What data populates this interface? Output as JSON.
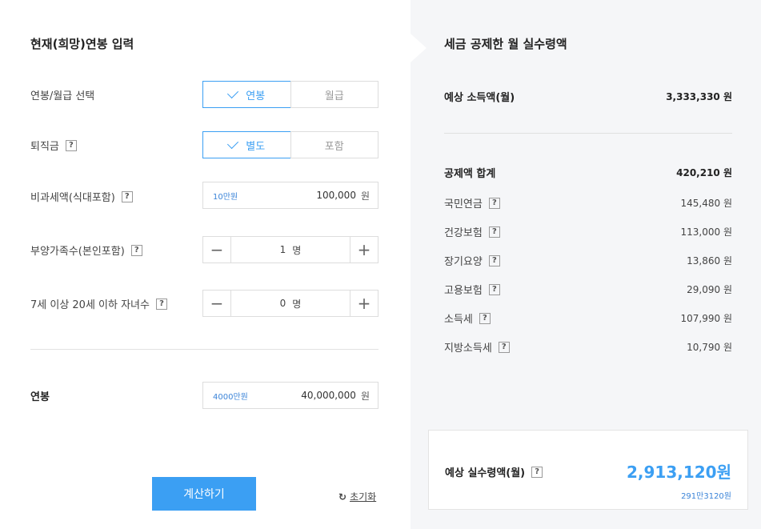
{
  "left": {
    "title": "현재(희망)연봉 입력",
    "salary_type": {
      "label": "연봉/월급 선택",
      "options": [
        "연봉",
        "월급"
      ],
      "selected": "연봉"
    },
    "severance": {
      "label": "퇴직금",
      "options": [
        "별도",
        "포함"
      ],
      "selected": "별도"
    },
    "nontaxable": {
      "label": "비과세액(식대포함)",
      "hint": "10만원",
      "value": "100,000",
      "unit": "원"
    },
    "dependents": {
      "label": "부양가족수(본인포함)",
      "value": "1",
      "unit": "명",
      "minus": "−",
      "plus": "+"
    },
    "children": {
      "label": "7세 이상 20세 이하 자녀수",
      "value": "0",
      "unit": "명",
      "minus": "−",
      "plus": "+"
    },
    "annual": {
      "label": "연봉",
      "hint": "4000만원",
      "value": "40,000,000",
      "unit": "원"
    },
    "calculate_label": "계산하기",
    "reset_label": "초기화",
    "help_glyph": "?"
  },
  "right": {
    "title": "세금 공제한 월 실수령액",
    "expected_income": {
      "label": "예상 소득액(월)",
      "value": "3,333,330 원"
    },
    "deduction_total": {
      "label": "공제액 합계",
      "value": "420,210 원"
    },
    "items": [
      {
        "label": "국민연금",
        "value": "145,480 원"
      },
      {
        "label": "건강보험",
        "value": "113,000 원"
      },
      {
        "label": "장기요양",
        "value": "13,860 원"
      },
      {
        "label": "고용보험",
        "value": "29,090 원"
      },
      {
        "label": "소득세",
        "value": "107,990 원"
      },
      {
        "label": "지방소득세",
        "value": "10,790 원"
      }
    ],
    "result": {
      "label": "예상 실수령액(월)",
      "value": "2,913,120원",
      "sub": "291만3120원"
    }
  },
  "colors": {
    "accent": "#3b9ff3",
    "panel_bg": "#f5f6f8"
  },
  "icons": {
    "check": "check-icon",
    "help": "help-icon",
    "reset": "refresh-icon"
  }
}
